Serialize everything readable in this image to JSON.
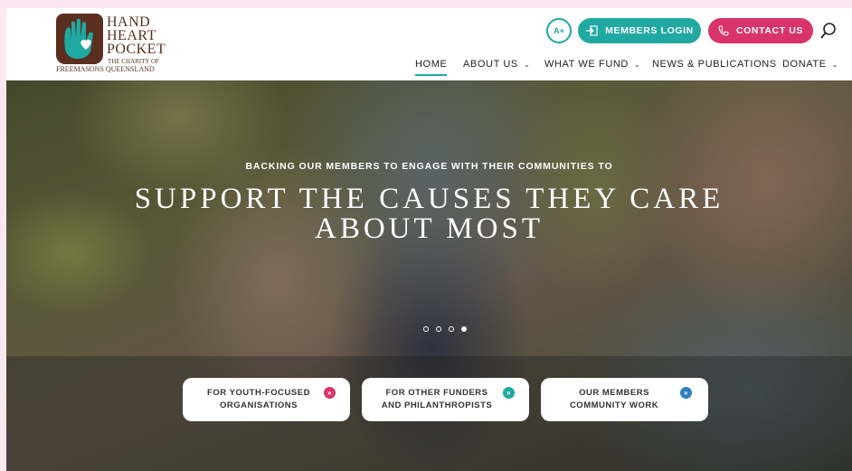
{
  "header": {
    "logo": {
      "line1": "HAND",
      "line2": "HEART",
      "line3": "POCKET",
      "sub1": "THE CHARITY OF",
      "sub2": "FREEMASONS QUEENSLAND"
    },
    "accessibility_label": "A+",
    "members_login_label": "MEMBERS LOGIN",
    "contact_label": "CONTACT US"
  },
  "nav": {
    "items": [
      {
        "label": "HOME",
        "active": true
      },
      {
        "label": "ABOUT US",
        "dropdown": true
      },
      {
        "label": "WHAT WE FUND",
        "dropdown": true
      },
      {
        "label": "NEWS & PUBLICATIONS"
      },
      {
        "label": "DONATE",
        "dropdown": true
      }
    ]
  },
  "hero": {
    "kicker": "BACKING OUR MEMBERS TO ENGAGE WITH THEIR COMMUNITIES TO",
    "title": "SUPPORT THE CAUSES THEY CARE ABOUT MOST",
    "slides": 4,
    "active_slide": 4
  },
  "cards": [
    {
      "label": "FOR YOUTH-FOCUSED ORGANISATIONS",
      "accent": "#d9336b"
    },
    {
      "label": "FOR OTHER FUNDERS AND PHILANTHROPISTS",
      "accent": "#1fa9a1"
    },
    {
      "label": "OUR MEMBERS COMMUNITY WORK",
      "accent": "#2f7fc1"
    }
  ],
  "colors": {
    "teal": "#1fa9a1",
    "pink": "#d9336b",
    "blue": "#2f7fc1",
    "brown": "#5a2f1f"
  }
}
